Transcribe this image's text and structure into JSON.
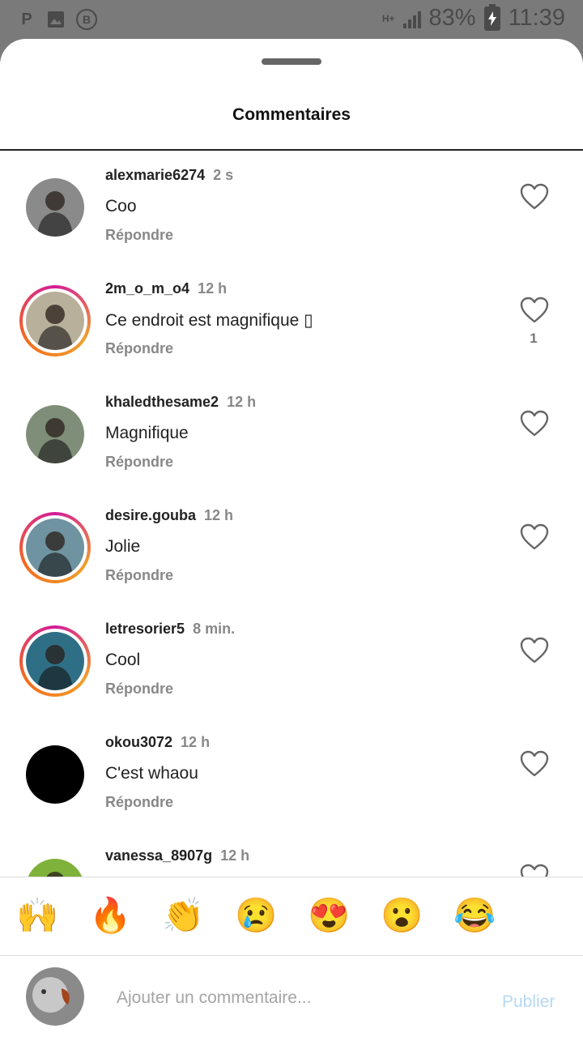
{
  "status_bar": {
    "left_icons": [
      "p-icon",
      "image-icon",
      "b-icon"
    ],
    "p_glyph": "P",
    "b_glyph": "B",
    "network": "H+",
    "battery": "83%",
    "time": "11:39"
  },
  "sheet": {
    "title": "Commentaires"
  },
  "comments": [
    {
      "username": "alexmarie6274",
      "time": "2 s",
      "text": "Coo",
      "reply": "Répondre",
      "likes": "",
      "story_ring": false,
      "avatar_color": "#8a8a8a"
    },
    {
      "username": "2m_o_m_o4",
      "time": "12 h",
      "text": "Ce endroit est magnifique ▯",
      "reply": "Répondre",
      "likes": "1",
      "story_ring": true,
      "avatar_color": "#b9b09b"
    },
    {
      "username": "khaledthesame2",
      "time": "12 h",
      "text": "Magnifique",
      "reply": "Répondre",
      "likes": "",
      "story_ring": false,
      "avatar_color": "#7f8e78"
    },
    {
      "username": "desire.gouba",
      "time": "12 h",
      "text": "Jolie",
      "reply": "Répondre",
      "likes": "",
      "story_ring": true,
      "avatar_color": "#6f93a0"
    },
    {
      "username": "letresorier5",
      "time": "8 min.",
      "text": "Cool",
      "reply": "Répondre",
      "likes": "",
      "story_ring": true,
      "avatar_color": "#2f6f86"
    },
    {
      "username": "okou3072",
      "time": "12 h",
      "text": "C'est whaou",
      "reply": "Répondre",
      "likes": "",
      "story_ring": false,
      "avatar_color": "#000000"
    },
    {
      "username": "vanessa_8907g",
      "time": "12 h",
      "text": "",
      "reply": "",
      "likes": "",
      "story_ring": false,
      "avatar_color": "#7fb23a"
    }
  ],
  "emoji_bar": [
    "🙌",
    "🔥",
    "👏",
    "😢",
    "😍",
    "😮",
    "😂"
  ],
  "composer": {
    "placeholder": "Ajouter un commentaire...",
    "publish_label": "Publier"
  },
  "colors": {
    "accent_disabled": "#b6d8f5",
    "muted_text": "#888888",
    "status_bar": "#7a7a7a"
  }
}
